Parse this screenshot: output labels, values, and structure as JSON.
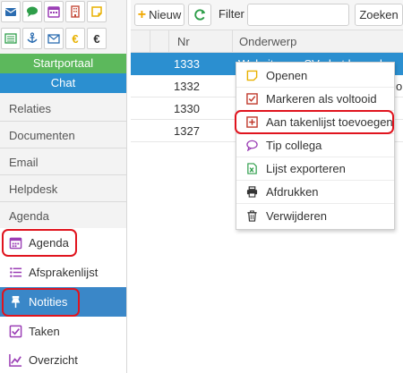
{
  "sidebar": {
    "icon_tiles": [
      {
        "icon": "mail-icon",
        "color": "#2b6cb0"
      },
      {
        "icon": "chat-bubble-icon",
        "color": "#2e9e4a"
      },
      {
        "icon": "calendar-icon",
        "color": "#9b3fb5"
      },
      {
        "icon": "building-icon",
        "color": "#c44b3a"
      },
      {
        "icon": "sticky-note-icon",
        "color": "#e8b100"
      },
      {
        "icon": "list-icon",
        "color": "#2e9e4a"
      },
      {
        "icon": "anchor-icon",
        "color": "#2b6cb0"
      },
      {
        "icon": "envelope-icon",
        "color": "#2b6cb0"
      },
      {
        "icon": "euro-yellow-icon",
        "color": "#e8b100"
      },
      {
        "icon": "euro-dark-icon",
        "color": "#333333"
      }
    ],
    "startportaal": "Startportaal",
    "chat": "Chat",
    "links": [
      "Relaties",
      "Documenten",
      "Email",
      "Helpdesk",
      "Agenda"
    ],
    "subitems": [
      "Agenda",
      "Afsprakenlijst",
      "Notities",
      "Taken",
      "Overzicht"
    ]
  },
  "toolbar": {
    "new_label": "Nieuw",
    "filter_label": "Filter",
    "filter_value": "",
    "search_label": "Zoeken"
  },
  "table": {
    "headers": {
      "nr": "Nr",
      "subject": "Onderwerp"
    },
    "rows": [
      {
        "nr": "1333",
        "subject": "Website pro-SV chat koppelen",
        "stub": ""
      },
      {
        "nr": "1332",
        "subject": "",
        "stub": "or"
      },
      {
        "nr": "1330",
        "subject": "",
        "stub": ""
      },
      {
        "nr": "1327",
        "subject": "",
        "stub": ""
      }
    ]
  },
  "context_menu": [
    {
      "label": "Openen",
      "icon": "sticky-note-icon"
    },
    {
      "label": "Markeren als voltooid",
      "icon": "check-square-icon"
    },
    {
      "label": "Aan takenlijst toevoegen",
      "icon": "plus-square-icon"
    },
    {
      "label": "Tip collega",
      "icon": "speech-bubble-icon"
    },
    {
      "label": "Lijst exporteren",
      "icon": "excel-icon"
    },
    {
      "label": "Afdrukken",
      "icon": "printer-icon"
    },
    {
      "label": "Verwijderen",
      "icon": "trash-icon"
    }
  ]
}
